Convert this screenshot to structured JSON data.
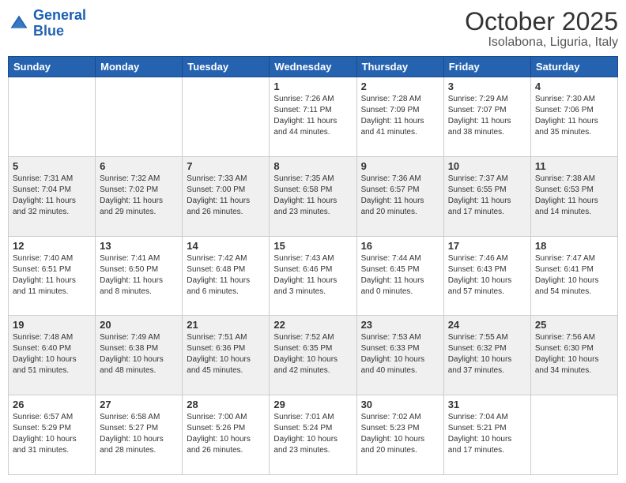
{
  "header": {
    "logo_general": "General",
    "logo_blue": "Blue",
    "month": "October 2025",
    "location": "Isolabona, Liguria, Italy"
  },
  "days_of_week": [
    "Sunday",
    "Monday",
    "Tuesday",
    "Wednesday",
    "Thursday",
    "Friday",
    "Saturday"
  ],
  "weeks": [
    [
      {
        "day": "",
        "sunrise": "",
        "sunset": "",
        "daylight": ""
      },
      {
        "day": "",
        "sunrise": "",
        "sunset": "",
        "daylight": ""
      },
      {
        "day": "",
        "sunrise": "",
        "sunset": "",
        "daylight": ""
      },
      {
        "day": "1",
        "sunrise": "Sunrise: 7:26 AM",
        "sunset": "Sunset: 7:11 PM",
        "daylight": "Daylight: 11 hours and 44 minutes."
      },
      {
        "day": "2",
        "sunrise": "Sunrise: 7:28 AM",
        "sunset": "Sunset: 7:09 PM",
        "daylight": "Daylight: 11 hours and 41 minutes."
      },
      {
        "day": "3",
        "sunrise": "Sunrise: 7:29 AM",
        "sunset": "Sunset: 7:07 PM",
        "daylight": "Daylight: 11 hours and 38 minutes."
      },
      {
        "day": "4",
        "sunrise": "Sunrise: 7:30 AM",
        "sunset": "Sunset: 7:06 PM",
        "daylight": "Daylight: 11 hours and 35 minutes."
      }
    ],
    [
      {
        "day": "5",
        "sunrise": "Sunrise: 7:31 AM",
        "sunset": "Sunset: 7:04 PM",
        "daylight": "Daylight: 11 hours and 32 minutes."
      },
      {
        "day": "6",
        "sunrise": "Sunrise: 7:32 AM",
        "sunset": "Sunset: 7:02 PM",
        "daylight": "Daylight: 11 hours and 29 minutes."
      },
      {
        "day": "7",
        "sunrise": "Sunrise: 7:33 AM",
        "sunset": "Sunset: 7:00 PM",
        "daylight": "Daylight: 11 hours and 26 minutes."
      },
      {
        "day": "8",
        "sunrise": "Sunrise: 7:35 AM",
        "sunset": "Sunset: 6:58 PM",
        "daylight": "Daylight: 11 hours and 23 minutes."
      },
      {
        "day": "9",
        "sunrise": "Sunrise: 7:36 AM",
        "sunset": "Sunset: 6:57 PM",
        "daylight": "Daylight: 11 hours and 20 minutes."
      },
      {
        "day": "10",
        "sunrise": "Sunrise: 7:37 AM",
        "sunset": "Sunset: 6:55 PM",
        "daylight": "Daylight: 11 hours and 17 minutes."
      },
      {
        "day": "11",
        "sunrise": "Sunrise: 7:38 AM",
        "sunset": "Sunset: 6:53 PM",
        "daylight": "Daylight: 11 hours and 14 minutes."
      }
    ],
    [
      {
        "day": "12",
        "sunrise": "Sunrise: 7:40 AM",
        "sunset": "Sunset: 6:51 PM",
        "daylight": "Daylight: 11 hours and 11 minutes."
      },
      {
        "day": "13",
        "sunrise": "Sunrise: 7:41 AM",
        "sunset": "Sunset: 6:50 PM",
        "daylight": "Daylight: 11 hours and 8 minutes."
      },
      {
        "day": "14",
        "sunrise": "Sunrise: 7:42 AM",
        "sunset": "Sunset: 6:48 PM",
        "daylight": "Daylight: 11 hours and 6 minutes."
      },
      {
        "day": "15",
        "sunrise": "Sunrise: 7:43 AM",
        "sunset": "Sunset: 6:46 PM",
        "daylight": "Daylight: 11 hours and 3 minutes."
      },
      {
        "day": "16",
        "sunrise": "Sunrise: 7:44 AM",
        "sunset": "Sunset: 6:45 PM",
        "daylight": "Daylight: 11 hours and 0 minutes."
      },
      {
        "day": "17",
        "sunrise": "Sunrise: 7:46 AM",
        "sunset": "Sunset: 6:43 PM",
        "daylight": "Daylight: 10 hours and 57 minutes."
      },
      {
        "day": "18",
        "sunrise": "Sunrise: 7:47 AM",
        "sunset": "Sunset: 6:41 PM",
        "daylight": "Daylight: 10 hours and 54 minutes."
      }
    ],
    [
      {
        "day": "19",
        "sunrise": "Sunrise: 7:48 AM",
        "sunset": "Sunset: 6:40 PM",
        "daylight": "Daylight: 10 hours and 51 minutes."
      },
      {
        "day": "20",
        "sunrise": "Sunrise: 7:49 AM",
        "sunset": "Sunset: 6:38 PM",
        "daylight": "Daylight: 10 hours and 48 minutes."
      },
      {
        "day": "21",
        "sunrise": "Sunrise: 7:51 AM",
        "sunset": "Sunset: 6:36 PM",
        "daylight": "Daylight: 10 hours and 45 minutes."
      },
      {
        "day": "22",
        "sunrise": "Sunrise: 7:52 AM",
        "sunset": "Sunset: 6:35 PM",
        "daylight": "Daylight: 10 hours and 42 minutes."
      },
      {
        "day": "23",
        "sunrise": "Sunrise: 7:53 AM",
        "sunset": "Sunset: 6:33 PM",
        "daylight": "Daylight: 10 hours and 40 minutes."
      },
      {
        "day": "24",
        "sunrise": "Sunrise: 7:55 AM",
        "sunset": "Sunset: 6:32 PM",
        "daylight": "Daylight: 10 hours and 37 minutes."
      },
      {
        "day": "25",
        "sunrise": "Sunrise: 7:56 AM",
        "sunset": "Sunset: 6:30 PM",
        "daylight": "Daylight: 10 hours and 34 minutes."
      }
    ],
    [
      {
        "day": "26",
        "sunrise": "Sunrise: 6:57 AM",
        "sunset": "Sunset: 5:29 PM",
        "daylight": "Daylight: 10 hours and 31 minutes."
      },
      {
        "day": "27",
        "sunrise": "Sunrise: 6:58 AM",
        "sunset": "Sunset: 5:27 PM",
        "daylight": "Daylight: 10 hours and 28 minutes."
      },
      {
        "day": "28",
        "sunrise": "Sunrise: 7:00 AM",
        "sunset": "Sunset: 5:26 PM",
        "daylight": "Daylight: 10 hours and 26 minutes."
      },
      {
        "day": "29",
        "sunrise": "Sunrise: 7:01 AM",
        "sunset": "Sunset: 5:24 PM",
        "daylight": "Daylight: 10 hours and 23 minutes."
      },
      {
        "day": "30",
        "sunrise": "Sunrise: 7:02 AM",
        "sunset": "Sunset: 5:23 PM",
        "daylight": "Daylight: 10 hours and 20 minutes."
      },
      {
        "day": "31",
        "sunrise": "Sunrise: 7:04 AM",
        "sunset": "Sunset: 5:21 PM",
        "daylight": "Daylight: 10 hours and 17 minutes."
      },
      {
        "day": "",
        "sunrise": "",
        "sunset": "",
        "daylight": ""
      }
    ]
  ]
}
